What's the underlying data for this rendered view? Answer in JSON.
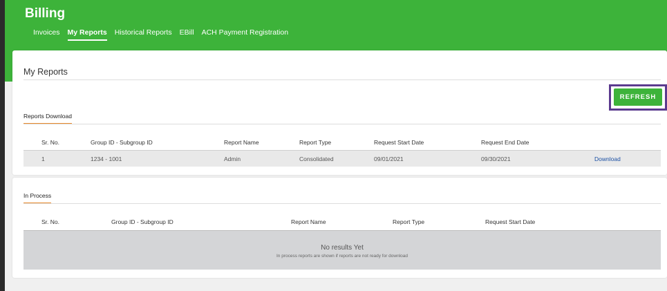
{
  "header": {
    "title": "Billing",
    "nav": [
      "Invoices",
      "My Reports",
      "Historical Reports",
      "EBill",
      "ACH Payment Registration"
    ],
    "active_nav": "My Reports"
  },
  "page": {
    "title": "My Reports",
    "refresh_label": "REFRESH"
  },
  "reports_download": {
    "tab_label": "Reports Download",
    "columns": [
      "Sr. No.",
      "Group ID - Subgroup ID",
      "Report Name",
      "Report Type",
      "Request Start Date",
      "Request End Date"
    ],
    "rows": [
      {
        "sr_no": "1",
        "group_id": "1234 - 1001",
        "report_name": "Admin",
        "report_type": "Consolidated",
        "start_date": "09/01/2021",
        "end_date": "09/30/2021",
        "action": "Download"
      }
    ]
  },
  "in_process": {
    "tab_label": "In Process",
    "columns": [
      "Sr. No.",
      "Group ID - Subgroup ID",
      "Report Name",
      "Report Type",
      "Request Start Date"
    ],
    "empty_title": "No results Yet",
    "empty_subtitle": "In process reports are shown if reports are not ready for download"
  },
  "colors": {
    "brand_green": "#3db33a",
    "tab_underline": "#e8892b",
    "highlight_outline": "#5b3a8e",
    "link": "#1a4fa3"
  }
}
